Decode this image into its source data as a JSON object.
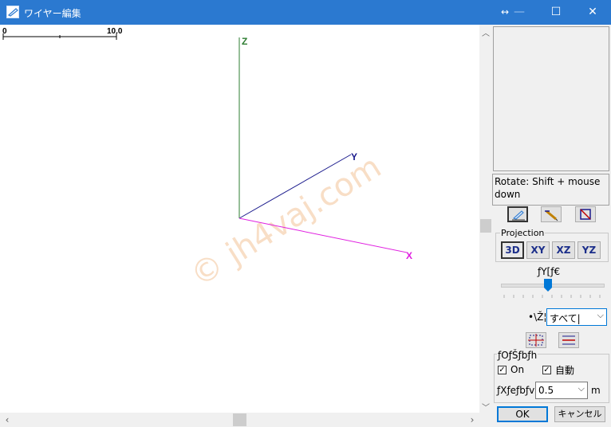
{
  "window": {
    "title": "ワイヤー編集",
    "buttons": {
      "restore_symbol": "↔",
      "minimize_symbol": "—",
      "maximize_symbol": "☐",
      "close_symbol": "✕"
    }
  },
  "viewport": {
    "scale_start": "0",
    "scale_end": "10.0",
    "axes": {
      "z_label": "Z",
      "y_label": "Y",
      "x_label": "X"
    },
    "axis_colors": {
      "z": "#2e7d32",
      "y": "#1a1a8c",
      "x": "#e020e0"
    },
    "watermark": "© jh4vaj.com"
  },
  "sidebar": {
    "hint_text": "Rotate: Shift + mouse down",
    "projection": {
      "group_label": "Projection",
      "buttons": [
        "3D",
        "XY",
        "XZ",
        "YZ"
      ],
      "active": "3D"
    },
    "zoom_label": "ƒY[ƒ€",
    "slider": {
      "value_fraction": 0.46
    },
    "display_label": "•\\Ž¦",
    "display_select": {
      "value": "すべて|"
    },
    "options": {
      "group_label": "ƒOƒŠƒbƒh",
      "on_checkbox": {
        "label": "On",
        "checked": true
      },
      "auto_checkbox": {
        "label": "自動",
        "checked": true
      },
      "step_label": "ƒXƒeƒbƒv",
      "step_select": {
        "value": "0.5"
      },
      "unit": "m"
    },
    "ok_label": "OK",
    "cancel_label": "キャンセル"
  }
}
